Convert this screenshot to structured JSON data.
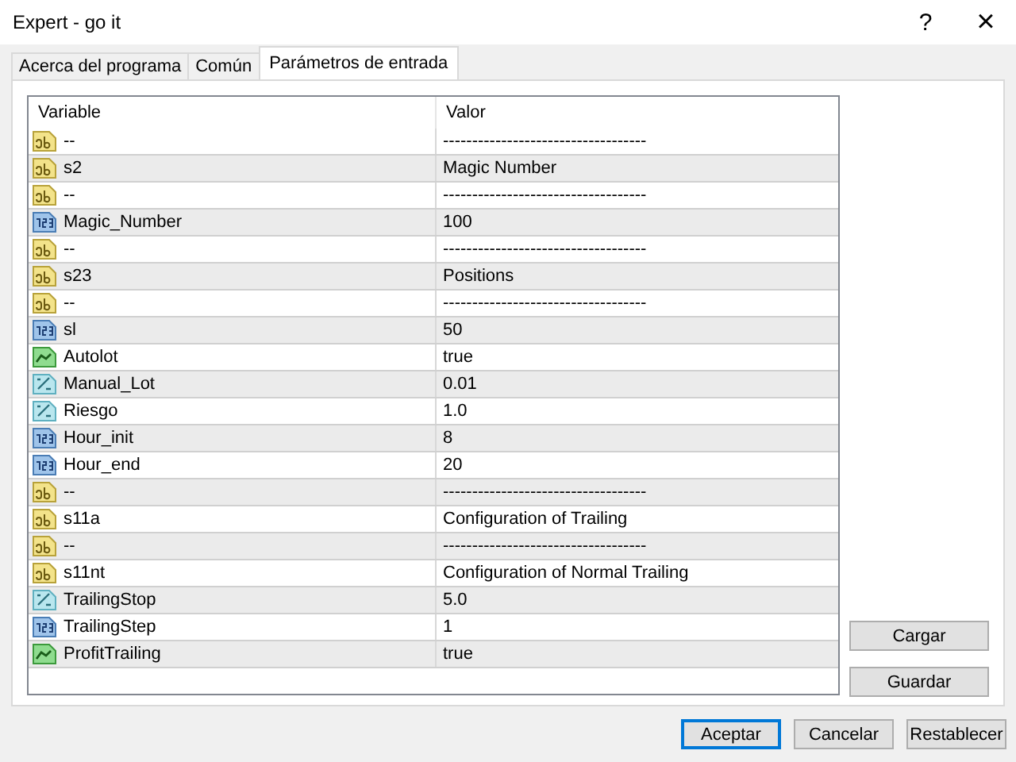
{
  "window": {
    "title": "Expert - go it",
    "help_button": "?",
    "close_button": "×"
  },
  "tabs": [
    {
      "label": "Acerca del programa",
      "selected": false
    },
    {
      "label": "Común",
      "selected": false
    },
    {
      "label": "Parámetros de entrada",
      "selected": true
    }
  ],
  "table": {
    "columns": [
      "Variable",
      "Valor"
    ],
    "rows": [
      {
        "kind": "string",
        "variable": "--",
        "value": "-----------------------------------"
      },
      {
        "kind": "string",
        "variable": "s2",
        "value": "Magic Number"
      },
      {
        "kind": "string",
        "variable": "--",
        "value": "-----------------------------------"
      },
      {
        "kind": "int",
        "variable": "Magic_Number",
        "value": "100"
      },
      {
        "kind": "string",
        "variable": "--",
        "value": "-----------------------------------"
      },
      {
        "kind": "string",
        "variable": "s23",
        "value": "Positions"
      },
      {
        "kind": "string",
        "variable": "--",
        "value": "-----------------------------------"
      },
      {
        "kind": "int",
        "variable": "sl",
        "value": "50"
      },
      {
        "kind": "bool",
        "variable": "Autolot",
        "value": "true"
      },
      {
        "kind": "double",
        "variable": "Manual_Lot",
        "value": "0.01"
      },
      {
        "kind": "double",
        "variable": "Riesgo",
        "value": "1.0"
      },
      {
        "kind": "int",
        "variable": "Hour_init",
        "value": "8"
      },
      {
        "kind": "int",
        "variable": "Hour_end",
        "value": "20"
      },
      {
        "kind": "string",
        "variable": "--",
        "value": "-----------------------------------"
      },
      {
        "kind": "string",
        "variable": "s11a",
        "value": "Configuration of Trailing"
      },
      {
        "kind": "string",
        "variable": "--",
        "value": "-----------------------------------"
      },
      {
        "kind": "string",
        "variable": "s11nt",
        "value": "Configuration of Normal Trailing"
      },
      {
        "kind": "double",
        "variable": "TrailingStop",
        "value": "5.0"
      },
      {
        "kind": "int",
        "variable": "TrailingStep",
        "value": "1"
      },
      {
        "kind": "bool",
        "variable": "ProfitTrailing",
        "value": "true"
      }
    ]
  },
  "side_buttons": [
    "Cargar",
    "Guardar"
  ],
  "buttons": [
    {
      "label": "Aceptar",
      "default": true
    },
    {
      "label": "Cancelar",
      "default": false
    },
    {
      "label": "Restablecer",
      "default": false
    }
  ]
}
